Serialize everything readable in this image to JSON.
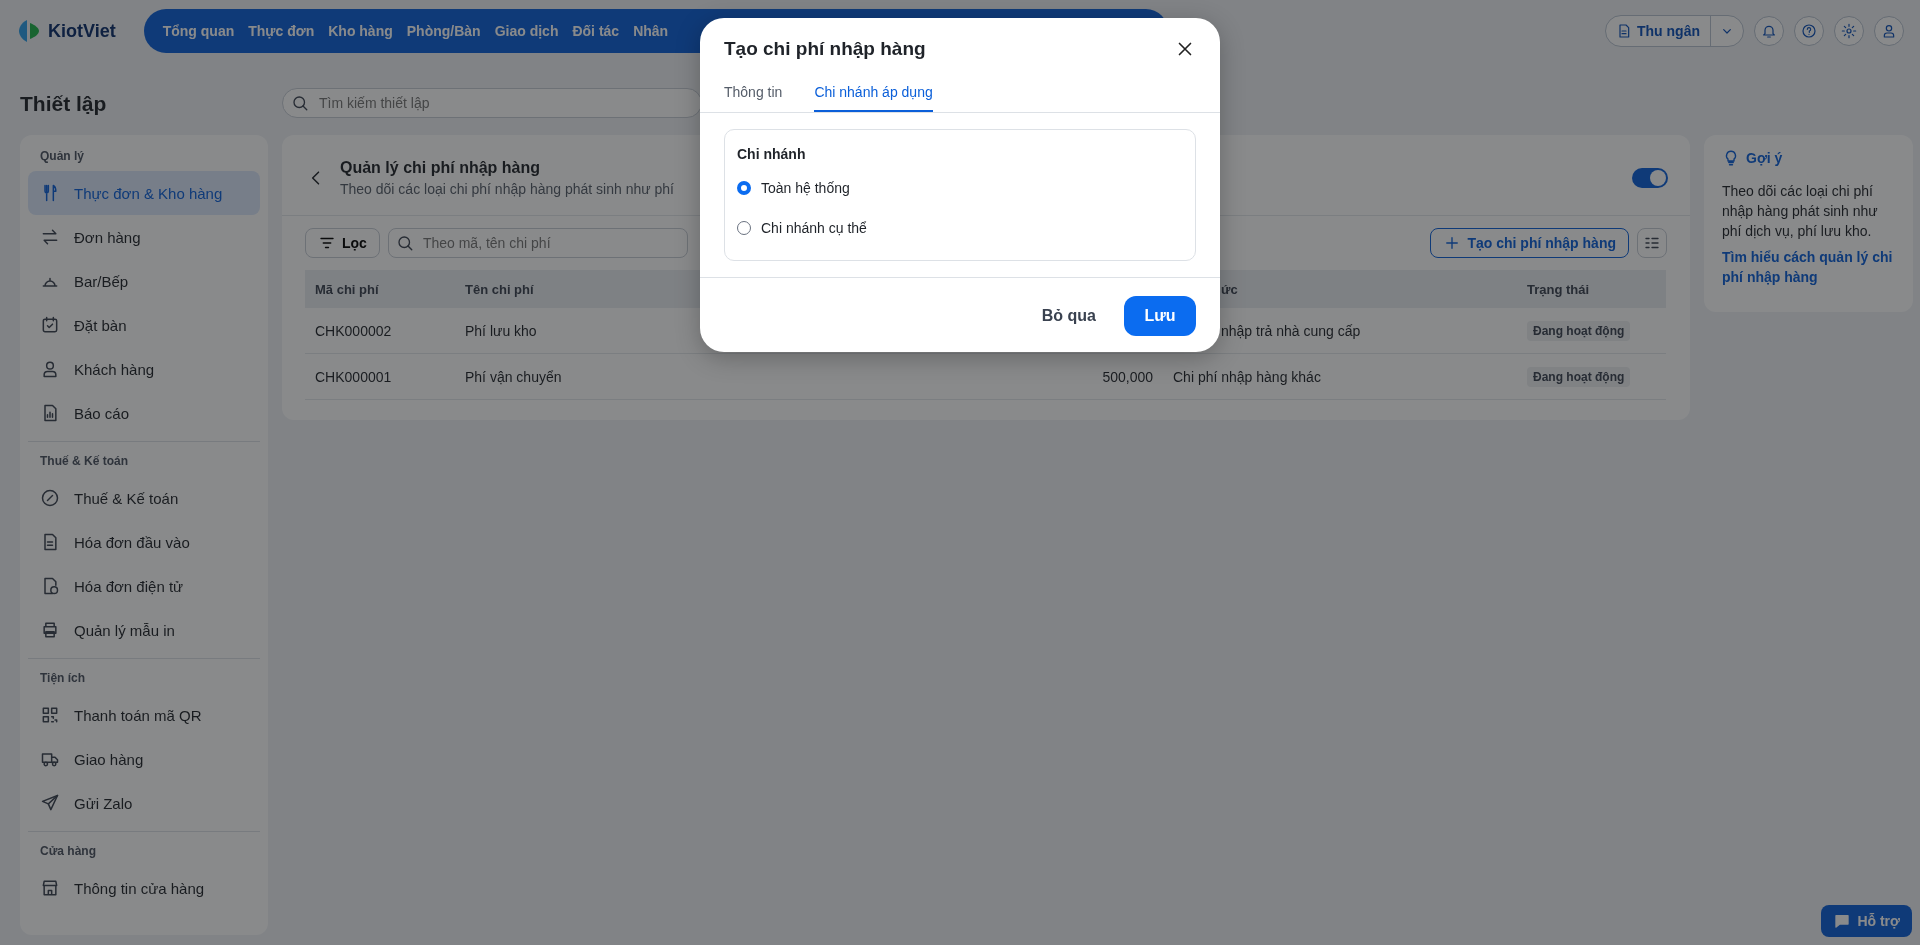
{
  "brand": {
    "name": "KiotViet"
  },
  "nav": [
    {
      "label": "Tổng quan"
    },
    {
      "label": "Thực đơn"
    },
    {
      "label": "Kho hàng"
    },
    {
      "label": "Phòng/Bàn"
    },
    {
      "label": "Giao dịch"
    },
    {
      "label": "Đối tác"
    },
    {
      "label": "Nhân"
    }
  ],
  "account": {
    "label": "Thu ngân"
  },
  "page_title": "Thiết lập",
  "settings_search": {
    "placeholder": "Tìm kiếm thiết lập"
  },
  "sidebar": {
    "sections": [
      {
        "heading": "Quản lý",
        "items": [
          {
            "label": "Thực đơn & Kho hàng",
            "selected": true
          },
          {
            "label": "Đơn hàng",
            "selected": false
          },
          {
            "label": "Bar/Bếp",
            "selected": false
          },
          {
            "label": "Đặt bàn",
            "selected": false
          },
          {
            "label": "Khách hàng",
            "selected": false
          },
          {
            "label": "Báo cáo",
            "selected": false
          }
        ]
      },
      {
        "heading": "Thuế & Kế toán",
        "items": [
          {
            "label": "Thuế & Kế toán",
            "selected": false
          },
          {
            "label": "Hóa đơn đầu vào",
            "selected": false
          },
          {
            "label": "Hóa đơn điện tử",
            "selected": false
          },
          {
            "label": "Quản lý mẫu in",
            "selected": false
          }
        ]
      },
      {
        "heading": "Tiện ích",
        "items": [
          {
            "label": "Thanh toán mã QR",
            "selected": false
          },
          {
            "label": "Giao hàng",
            "selected": false
          },
          {
            "label": "Gửi Zalo",
            "selected": false
          }
        ]
      },
      {
        "heading": "Cửa hàng",
        "items": [
          {
            "label": "Thông tin cửa hàng",
            "selected": false
          }
        ]
      }
    ]
  },
  "panel": {
    "title": "Quản lý chi phí nhập hàng",
    "subtitle": "Theo dõi các loại chi phí nhập hàng phát sinh như phí",
    "toggle": {
      "on": true
    },
    "filter_button": "Lọc",
    "search": {
      "placeholder": "Theo mã, tên chi phí"
    },
    "create_button": "Tạo chi phí nhập hàng",
    "table": {
      "columns": {
        "code": "Mã chi phí",
        "name": "Tên chi phí",
        "type": "ức",
        "status": "Trạng thái"
      },
      "rows": [
        {
          "code": "CHK000002",
          "name": "Phí lưu kho",
          "type": "nhập trả nhà cung cấp",
          "status": "Đang hoạt động"
        },
        {
          "code": "CHK000001",
          "name": "Phí vận chuyển",
          "amount": "500,000",
          "type": "Chi phí nhập hàng khác",
          "status": "Đang hoạt động"
        }
      ]
    }
  },
  "hint": {
    "title": "Gợi ý",
    "text": "Theo dõi các loại chi phí nhập hàng phát sinh như phí dịch vụ, phí lưu kho.",
    "link": "Tìm hiểu cách quản lý chi phí nhập hàng"
  },
  "support_button": "Hỗ trợ",
  "dialog": {
    "title": "Tạo chi phí nhập hàng",
    "tabs": [
      {
        "label": "Thông tin",
        "selected": false
      },
      {
        "label": "Chi nhánh áp dụng",
        "selected": true
      }
    ],
    "group_label": "Chi nhánh",
    "options": [
      {
        "label": "Toàn hệ thống",
        "selected": true
      },
      {
        "label": "Chi nhánh cụ thể",
        "selected": false
      }
    ],
    "cancel_button": "Bỏ qua",
    "save_button": "Lưu"
  }
}
